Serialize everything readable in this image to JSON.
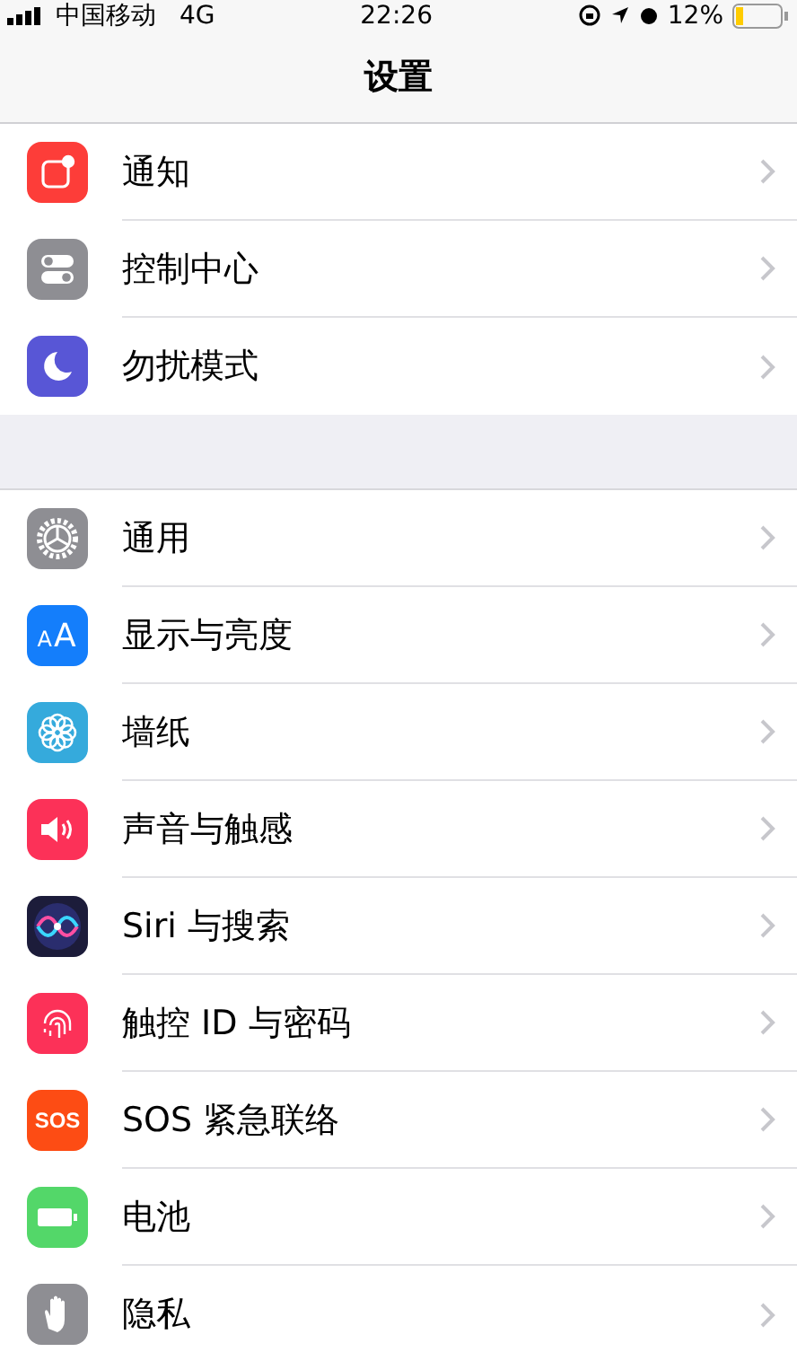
{
  "status_bar": {
    "carrier": "中国移动",
    "network": "4G",
    "time": "22:26",
    "battery_percent": "12%"
  },
  "nav_bar": {
    "title": "设置"
  },
  "groups": [
    {
      "items": [
        {
          "kind": "notifications",
          "label": "通知",
          "color": "#fd3d39"
        },
        {
          "kind": "control",
          "label": "控制中心",
          "color": "#8e8e93"
        },
        {
          "kind": "moon",
          "label": "勿扰模式",
          "color": "#5856d6"
        }
      ]
    },
    {
      "items": [
        {
          "kind": "gear",
          "label": "通用",
          "color": "#8e8e93"
        },
        {
          "kind": "display",
          "label": "显示与亮度",
          "color": "#147efb",
          "icon_text": "AA"
        },
        {
          "kind": "flower",
          "label": "墙纸",
          "color": "#35aadc"
        },
        {
          "kind": "sound",
          "label": "声音与触感",
          "color": "#fc3158"
        },
        {
          "kind": "siri",
          "label": "Siri 与搜索",
          "color": "#1c1c3a"
        },
        {
          "kind": "fingerprint",
          "label": "触控 ID 与密码",
          "color": "#fc3158"
        },
        {
          "kind": "sos",
          "label": "SOS 紧急联络",
          "color": "#fd4c14",
          "icon_text": "SOS"
        },
        {
          "kind": "battery",
          "label": "电池",
          "color": "#53d769"
        },
        {
          "kind": "hand",
          "label": "隐私",
          "color": "#8e8e93"
        }
      ]
    }
  ]
}
